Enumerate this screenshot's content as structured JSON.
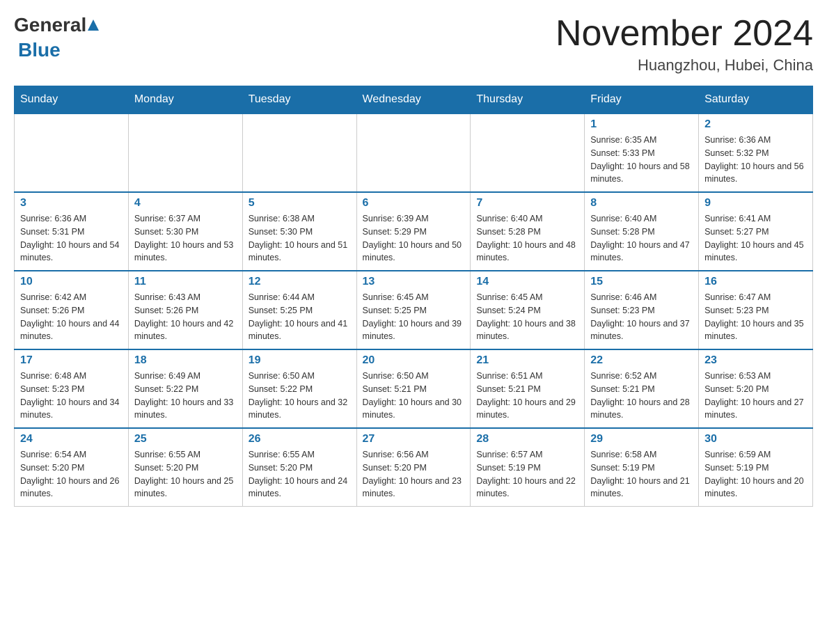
{
  "header": {
    "logo": {
      "general": "General",
      "blue": "Blue"
    },
    "title": "November 2024",
    "location": "Huangzhou, Hubei, China"
  },
  "weekdays": [
    "Sunday",
    "Monday",
    "Tuesday",
    "Wednesday",
    "Thursday",
    "Friday",
    "Saturday"
  ],
  "weeks": [
    [
      {
        "day": "",
        "info": ""
      },
      {
        "day": "",
        "info": ""
      },
      {
        "day": "",
        "info": ""
      },
      {
        "day": "",
        "info": ""
      },
      {
        "day": "",
        "info": ""
      },
      {
        "day": "1",
        "info": "Sunrise: 6:35 AM\nSunset: 5:33 PM\nDaylight: 10 hours and 58 minutes."
      },
      {
        "day": "2",
        "info": "Sunrise: 6:36 AM\nSunset: 5:32 PM\nDaylight: 10 hours and 56 minutes."
      }
    ],
    [
      {
        "day": "3",
        "info": "Sunrise: 6:36 AM\nSunset: 5:31 PM\nDaylight: 10 hours and 54 minutes."
      },
      {
        "day": "4",
        "info": "Sunrise: 6:37 AM\nSunset: 5:30 PM\nDaylight: 10 hours and 53 minutes."
      },
      {
        "day": "5",
        "info": "Sunrise: 6:38 AM\nSunset: 5:30 PM\nDaylight: 10 hours and 51 minutes."
      },
      {
        "day": "6",
        "info": "Sunrise: 6:39 AM\nSunset: 5:29 PM\nDaylight: 10 hours and 50 minutes."
      },
      {
        "day": "7",
        "info": "Sunrise: 6:40 AM\nSunset: 5:28 PM\nDaylight: 10 hours and 48 minutes."
      },
      {
        "day": "8",
        "info": "Sunrise: 6:40 AM\nSunset: 5:28 PM\nDaylight: 10 hours and 47 minutes."
      },
      {
        "day": "9",
        "info": "Sunrise: 6:41 AM\nSunset: 5:27 PM\nDaylight: 10 hours and 45 minutes."
      }
    ],
    [
      {
        "day": "10",
        "info": "Sunrise: 6:42 AM\nSunset: 5:26 PM\nDaylight: 10 hours and 44 minutes."
      },
      {
        "day": "11",
        "info": "Sunrise: 6:43 AM\nSunset: 5:26 PM\nDaylight: 10 hours and 42 minutes."
      },
      {
        "day": "12",
        "info": "Sunrise: 6:44 AM\nSunset: 5:25 PM\nDaylight: 10 hours and 41 minutes."
      },
      {
        "day": "13",
        "info": "Sunrise: 6:45 AM\nSunset: 5:25 PM\nDaylight: 10 hours and 39 minutes."
      },
      {
        "day": "14",
        "info": "Sunrise: 6:45 AM\nSunset: 5:24 PM\nDaylight: 10 hours and 38 minutes."
      },
      {
        "day": "15",
        "info": "Sunrise: 6:46 AM\nSunset: 5:23 PM\nDaylight: 10 hours and 37 minutes."
      },
      {
        "day": "16",
        "info": "Sunrise: 6:47 AM\nSunset: 5:23 PM\nDaylight: 10 hours and 35 minutes."
      }
    ],
    [
      {
        "day": "17",
        "info": "Sunrise: 6:48 AM\nSunset: 5:23 PM\nDaylight: 10 hours and 34 minutes."
      },
      {
        "day": "18",
        "info": "Sunrise: 6:49 AM\nSunset: 5:22 PM\nDaylight: 10 hours and 33 minutes."
      },
      {
        "day": "19",
        "info": "Sunrise: 6:50 AM\nSunset: 5:22 PM\nDaylight: 10 hours and 32 minutes."
      },
      {
        "day": "20",
        "info": "Sunrise: 6:50 AM\nSunset: 5:21 PM\nDaylight: 10 hours and 30 minutes."
      },
      {
        "day": "21",
        "info": "Sunrise: 6:51 AM\nSunset: 5:21 PM\nDaylight: 10 hours and 29 minutes."
      },
      {
        "day": "22",
        "info": "Sunrise: 6:52 AM\nSunset: 5:21 PM\nDaylight: 10 hours and 28 minutes."
      },
      {
        "day": "23",
        "info": "Sunrise: 6:53 AM\nSunset: 5:20 PM\nDaylight: 10 hours and 27 minutes."
      }
    ],
    [
      {
        "day": "24",
        "info": "Sunrise: 6:54 AM\nSunset: 5:20 PM\nDaylight: 10 hours and 26 minutes."
      },
      {
        "day": "25",
        "info": "Sunrise: 6:55 AM\nSunset: 5:20 PM\nDaylight: 10 hours and 25 minutes."
      },
      {
        "day": "26",
        "info": "Sunrise: 6:55 AM\nSunset: 5:20 PM\nDaylight: 10 hours and 24 minutes."
      },
      {
        "day": "27",
        "info": "Sunrise: 6:56 AM\nSunset: 5:20 PM\nDaylight: 10 hours and 23 minutes."
      },
      {
        "day": "28",
        "info": "Sunrise: 6:57 AM\nSunset: 5:19 PM\nDaylight: 10 hours and 22 minutes."
      },
      {
        "day": "29",
        "info": "Sunrise: 6:58 AM\nSunset: 5:19 PM\nDaylight: 10 hours and 21 minutes."
      },
      {
        "day": "30",
        "info": "Sunrise: 6:59 AM\nSunset: 5:19 PM\nDaylight: 10 hours and 20 minutes."
      }
    ]
  ]
}
